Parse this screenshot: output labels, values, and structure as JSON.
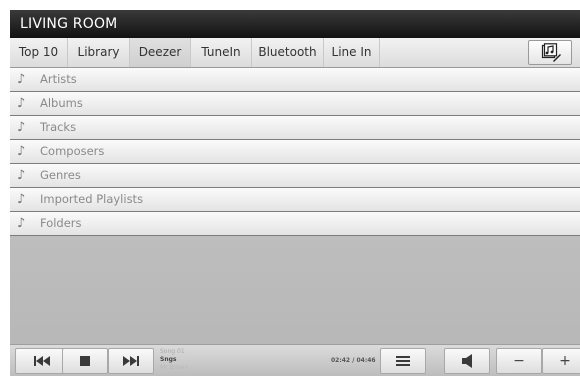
{
  "room": "LIVING ROOM",
  "tabs": [
    {
      "label": "Top 10"
    },
    {
      "label": "Library"
    },
    {
      "label": "Deezer"
    },
    {
      "label": "TuneIn"
    },
    {
      "label": "Bluetooth"
    },
    {
      "label": "Line In"
    }
  ],
  "active_tab": "Deezer",
  "icons": {
    "edit": "playlist-edit-icon",
    "item": "music-note-icon",
    "prev": "skip-previous-icon",
    "stop": "stop-icon",
    "next": "skip-next-icon",
    "queue": "queue-list-icon",
    "volume": "speaker-icon"
  },
  "library_items": [
    {
      "label": "Artists"
    },
    {
      "label": "Albums"
    },
    {
      "label": "Tracks"
    },
    {
      "label": "Composers"
    },
    {
      "label": "Genres"
    },
    {
      "label": "Imported Playlists"
    },
    {
      "label": "Folders"
    }
  ],
  "now_playing": {
    "line1": "Song 01",
    "line2": "Sngs",
    "line3": "Mr Brown",
    "time": "02:42 / 04:46"
  },
  "volume": {
    "minus": "−",
    "plus": "+"
  }
}
